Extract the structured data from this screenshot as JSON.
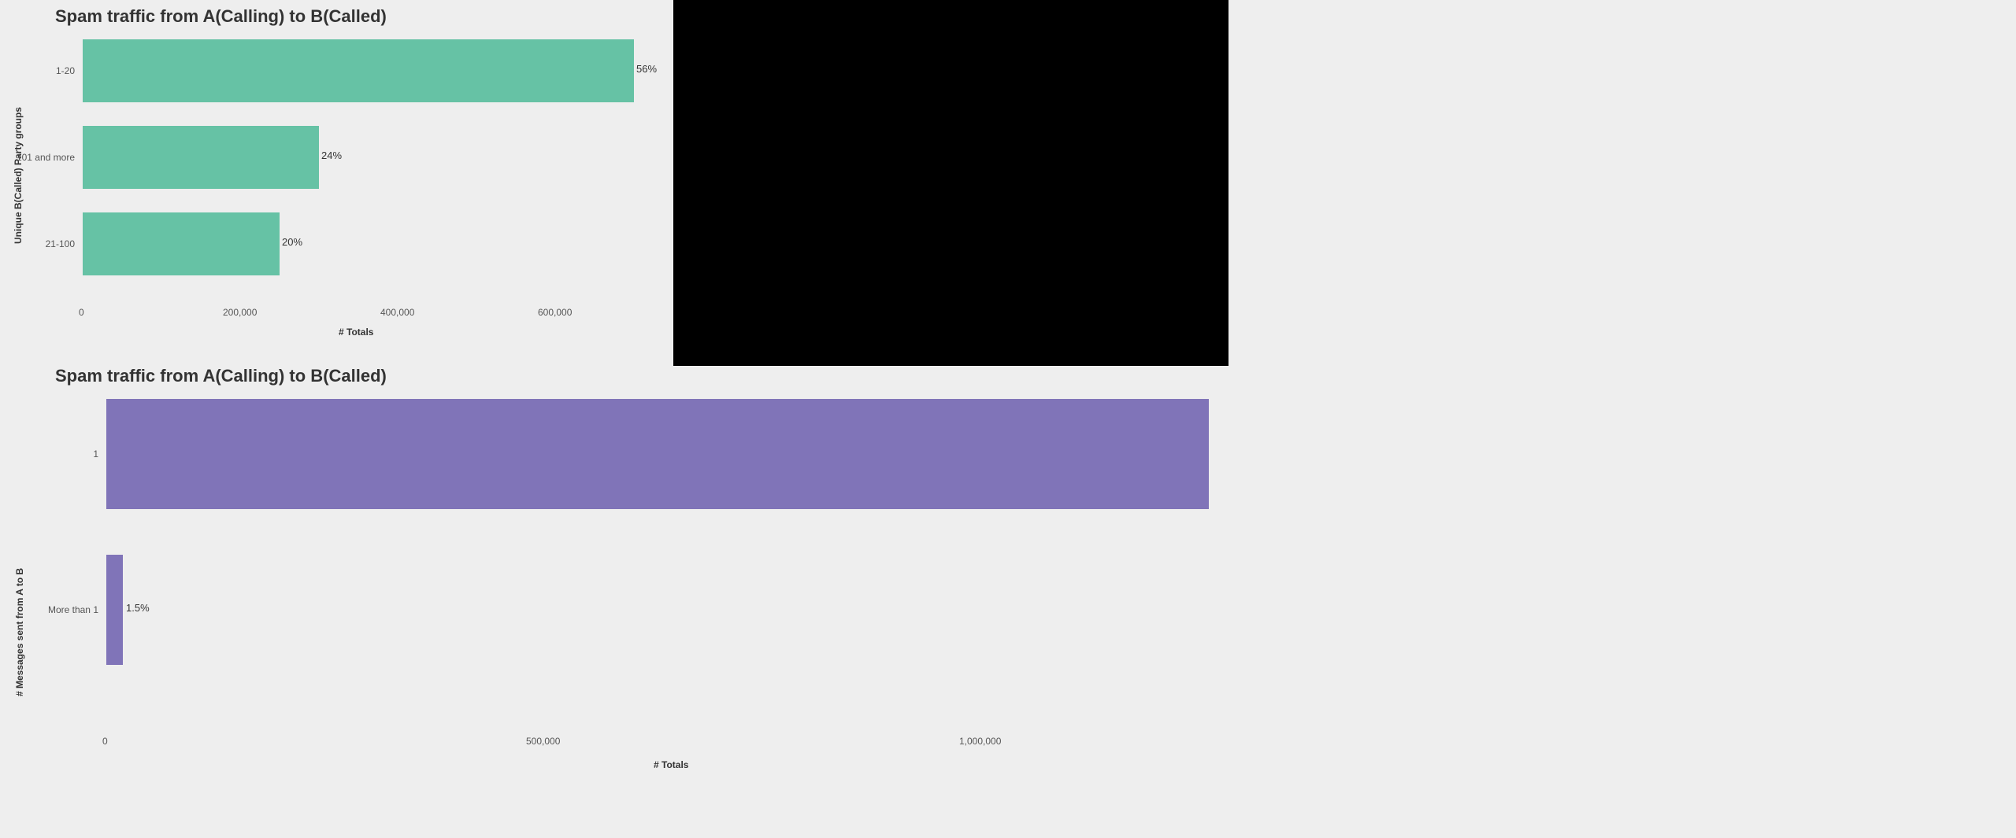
{
  "chart_data": [
    {
      "type": "bar",
      "orientation": "horizontal",
      "title": "Spam traffic from A(Calling) to B(Called)",
      "xlabel": "# Totals",
      "ylabel": "Unique B(Called) Party groups",
      "categories": [
        "1-20",
        "101 and more",
        "21-100"
      ],
      "values": [
        700000,
        300000,
        250000
      ],
      "percent_labels": [
        "56%",
        "24%",
        "20%"
      ],
      "x_ticks": [
        0,
        200000,
        400000,
        600000
      ],
      "x_tick_labels": [
        "0",
        "200,000",
        "400,000",
        "600,000"
      ],
      "xlim": [
        0,
        750000
      ],
      "color": "#66c2a5"
    },
    {
      "type": "bar",
      "orientation": "horizontal",
      "title": "Spam traffic from A(Calling) to B(Called)",
      "xlabel": "# Totals",
      "ylabel": "# Messages sent from A to B",
      "categories": [
        "1",
        "More than 1"
      ],
      "values": [
        1260000,
        19000
      ],
      "percent_labels": [
        "",
        "1.5%"
      ],
      "x_ticks": [
        0,
        500000,
        1000000
      ],
      "x_tick_labels": [
        "0",
        "500,000",
        "1,000,000"
      ],
      "xlim": [
        0,
        1280000
      ],
      "color": "#8074b8"
    }
  ],
  "top": {
    "title": "Spam traffic from A(Calling) to B(Called)",
    "ylabel": "Unique B(Called) Party groups",
    "xlabel": "# Totals",
    "cats": {
      "c0": "1-20",
      "c1": "101 and more",
      "c2": "21-100"
    },
    "labels": {
      "l0": "56%",
      "l1": "24%",
      "l2": "20%"
    },
    "xticks": {
      "t0": "0",
      "t1": "200,000",
      "t2": "400,000",
      "t3": "600,000"
    }
  },
  "bottom": {
    "title": "Spam traffic from A(Calling) to B(Called)",
    "ylabel": "# Messages sent from A to B",
    "xlabel": "# Totals",
    "cats": {
      "c0": "1",
      "c1": "More than 1"
    },
    "labels": {
      "l0": "",
      "l1": "1.5%"
    },
    "xticks": {
      "t0": "0",
      "t1": "500,000",
      "t2": "1,000,000"
    }
  }
}
